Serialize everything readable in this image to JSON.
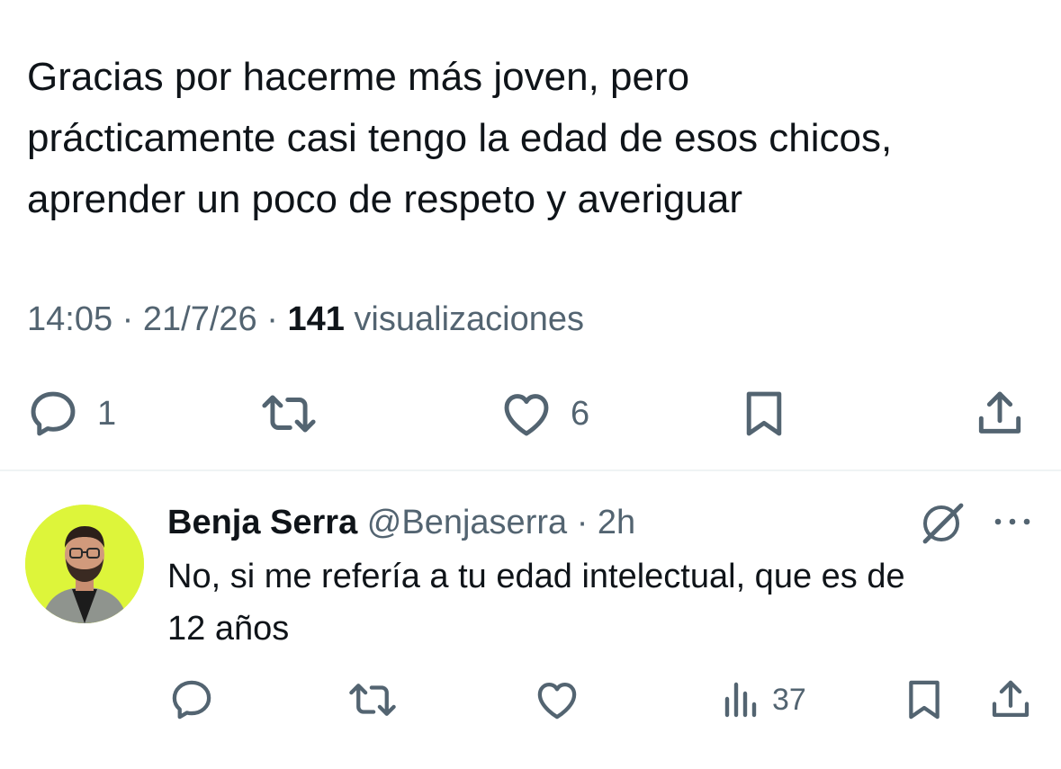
{
  "tweet": {
    "text_lines": [
      "Gracias por hacerme más joven, pero",
      "prácticamente casi tengo la edad de esos chicos,",
      "aprender un poco de respeto y averiguar"
    ],
    "time": "14:05",
    "sep1": " · ",
    "date": "21/7/26",
    "sep2": " · ",
    "views_count": "141",
    "views_label": " visualizaciones",
    "actions": {
      "reply_count": "1",
      "repost_count": "",
      "like_count": "6"
    }
  },
  "reply": {
    "name": "Benja Serra",
    "handle": "@Benjaserra",
    "sep": " · ",
    "age": "2h",
    "text_lines": [
      "No, si me refería a tu edad intelectual, que es de",
      "12 años"
    ],
    "actions": {
      "views_count": "37"
    }
  },
  "colors": {
    "text": "#0f1419",
    "secondary": "#536471",
    "avatar_bg": "#ddf53a",
    "divider": "#eff3f4"
  },
  "icons": [
    "reply-icon",
    "repost-icon",
    "like-icon",
    "bookmark-icon",
    "share-icon",
    "grok-icon",
    "more-icon",
    "views-icon"
  ]
}
